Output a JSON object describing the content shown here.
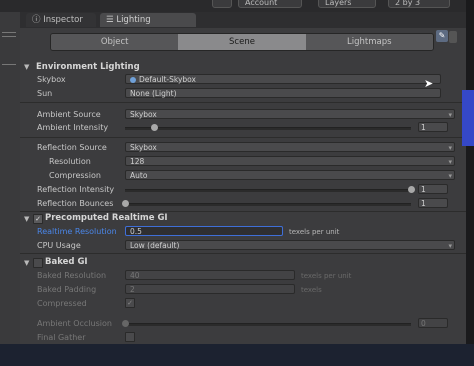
{
  "toolbar": {
    "account_label": "Account",
    "layers_label": "Layers",
    "layout_label": "2 by 3"
  },
  "tabs": {
    "inspector": "Inspector",
    "lighting": "Lighting"
  },
  "segments": [
    "Object",
    "Scene",
    "Lightmaps"
  ],
  "environment": {
    "title": "Environment Lighting",
    "skybox_label": "Skybox",
    "skybox_value": "Default-Skybox",
    "sun_label": "Sun",
    "sun_value": "None (Light)",
    "ambient_source_label": "Ambient Source",
    "ambient_source_value": "Skybox",
    "ambient_intensity_label": "Ambient Intensity",
    "ambient_intensity_value": "1",
    "reflection_source_label": "Reflection Source",
    "reflection_source_value": "Skybox",
    "resolution_label": "Resolution",
    "resolution_value": "128",
    "compression_label": "Compression",
    "compression_value": "Auto",
    "reflection_intensity_label": "Reflection Intensity",
    "reflection_intensity_value": "1",
    "reflection_bounces_label": "Reflection Bounces",
    "reflection_bounces_value": "1"
  },
  "realtime_gi": {
    "title": "Precomputed Realtime GI",
    "resolution_label": "Realtime Resolution",
    "resolution_value": "0.5",
    "resolution_unit": "texels per unit",
    "cpu_usage_label": "CPU Usage",
    "cpu_usage_value": "Low (default)"
  },
  "baked_gi": {
    "title": "Baked GI",
    "baked_resolution_label": "Baked Resolution",
    "baked_resolution_value": "40",
    "baked_resolution_unit": "texels per unit",
    "baked_padding_label": "Baked Padding",
    "baked_padding_value": "2",
    "baked_padding_unit": "texels",
    "compressed_label": "Compressed",
    "ambient_occlusion_label": "Ambient Occlusion",
    "ambient_occlusion_value": "0",
    "final_gather_label": "Final Gather"
  },
  "slider_levels": {
    "ambient_intensity": 0.1,
    "reflection_intensity": 1.0,
    "reflection_bounces": 0.0,
    "ambient_occlusion": 0.0
  },
  "icons": {
    "skybox_object": "circle-icon",
    "checkbox": "check-icon",
    "foldout": "triangle-down-icon"
  },
  "colors": {
    "selected_segment": "#8a8a8c",
    "focus_outline": "#3f6fd8",
    "highlight_label": "#4a86e8"
  }
}
